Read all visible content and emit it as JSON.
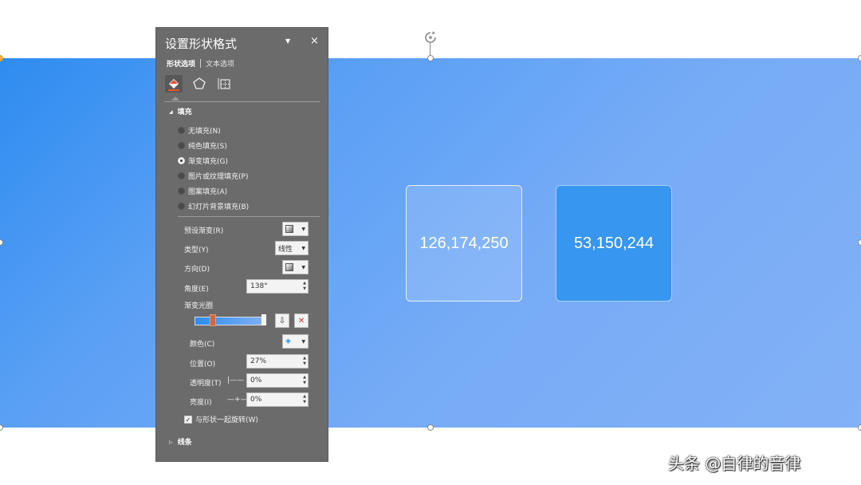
{
  "slide": {
    "card_1_value": "126,174,250",
    "card_2_value": "53,150,244",
    "colors": {
      "gradient_start": "#2e8cf0",
      "gradient_end": "#83b1f6",
      "card_2_bg": "#3796ef"
    }
  },
  "panel": {
    "title": "设置形状格式",
    "dropdown_icon": "dropdown-arrow-icon",
    "close_label": "×",
    "tabs": {
      "shape_options": "形状选项",
      "text_options": "文本选项"
    },
    "category_icons": [
      "fill-line-icon",
      "effects-pentagon-icon",
      "size-properties-icon"
    ],
    "fill_section": {
      "header": "填充",
      "options": [
        {
          "label": "无填充(N)",
          "checked": false
        },
        {
          "label": "纯色填充(S)",
          "checked": false
        },
        {
          "label": "渐变填充(G)",
          "checked": true
        },
        {
          "label": "图片或纹理填充(P)",
          "checked": false
        },
        {
          "label": "图案填充(A)",
          "checked": false
        },
        {
          "label": "幻灯片背景填充(B)",
          "checked": false
        }
      ],
      "preset_label": "预设渐变(R)",
      "type_label": "类型(Y)",
      "type_value": "线性",
      "direction_label": "方向(D)",
      "angle_label": "角度(E)",
      "angle_value": "138°",
      "stops_label": "渐变光圈",
      "color_label": "颜色(C)",
      "position_label": "位置(O)",
      "position_value": "27%",
      "transparency_label": "透明度(T)",
      "transparency_value": "0%",
      "brightness_label": "亮度(I)",
      "brightness_value": "0%",
      "rotate_with_shape_label": "与形状一起旋转(W)",
      "rotate_with_shape_checked": true
    },
    "line_section": {
      "header": "线条"
    }
  },
  "watermark": "头条 @自律的音律"
}
